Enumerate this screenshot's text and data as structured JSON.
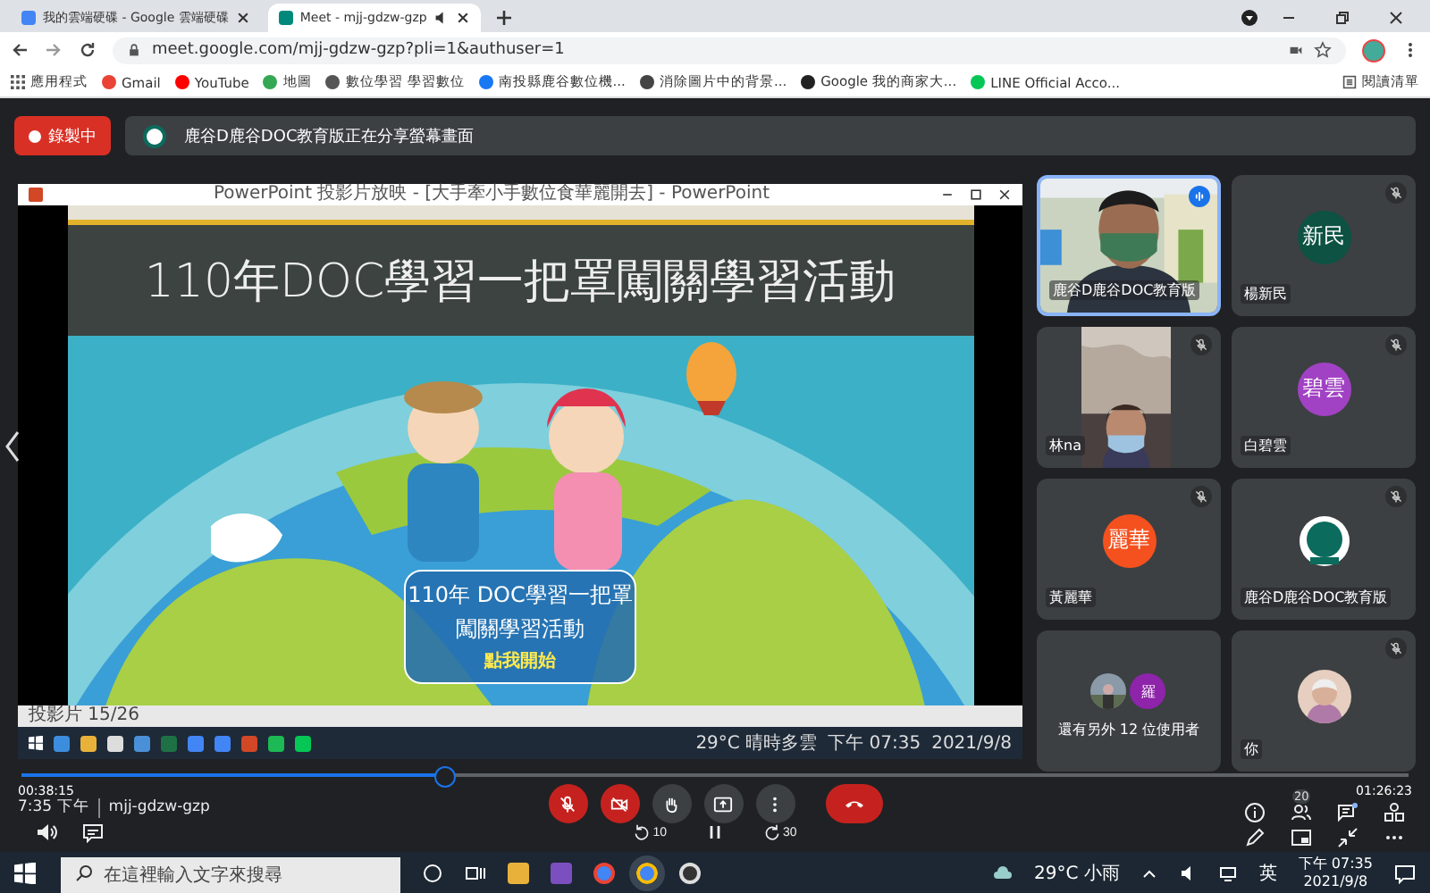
{
  "browser": {
    "tabs": [
      {
        "title": "我的雲端硬碟 - Google 雲端硬碟",
        "selected": false
      },
      {
        "title": "Meet - mjj-gdzw-gzp",
        "selected": true
      }
    ],
    "url": "meet.google.com/mjj-gdzw-gzp?pli=1&authuser=1",
    "bookmarks": [
      "應用程式",
      "Gmail",
      "YouTube",
      "地圖",
      "數位學習 學習數位",
      "南投縣鹿谷數位機...",
      "消除圖片中的背景...",
      "Google 我的商家大...",
      "LINE Official Acco..."
    ],
    "reading_list": "閱讀清單"
  },
  "meet": {
    "recording": "錄製中",
    "banner": "鹿谷D鹿谷DOC教育版正在分享螢幕畫面",
    "presentation": {
      "window_title": "PowerPoint 投影片放映 - [大手牽小手數位食華麗開去] - PowerPoint",
      "slide_title": "110年DOC學習一把罩闖關學習活動",
      "caption": [
        "110年 DOC學習一把罩",
        "闖關學習活動"
      ],
      "start_link": "點我開始",
      "status": "投影片 15/26",
      "taskbar": {
        "weather": "29°C 晴時多雲",
        "time": "下午 07:35",
        "date": "2021/9/8"
      }
    },
    "tiles": [
      {
        "kind": "video",
        "name": "鹿谷D鹿谷DOC教育版",
        "muted": false,
        "speaking": true
      },
      {
        "kind": "initials",
        "initials": "新民",
        "color": "#0d5243",
        "name": "楊新民",
        "muted": true,
        "speaking": false
      },
      {
        "kind": "video",
        "name": "林na",
        "muted": true,
        "speaking": false
      },
      {
        "kind": "initials",
        "initials": "碧雲",
        "color": "#a142c4",
        "name": "白碧雲",
        "muted": true,
        "speaking": false
      },
      {
        "kind": "initials",
        "initials": "麗華",
        "color": "#f4511e",
        "name": "黃麗華",
        "muted": true,
        "speaking": false
      },
      {
        "kind": "logo",
        "name": "鹿谷D鹿谷DOC教育版",
        "muted": true,
        "speaking": false
      },
      {
        "kind": "others",
        "label": "還有另外 12 位使用者",
        "initials": "羅",
        "color": "#8e24aa",
        "muted": false,
        "speaking": false
      },
      {
        "name": "你",
        "muted": true,
        "speaking": false
      }
    ],
    "player": {
      "elapsed": "00:38:15",
      "total": "01:26:23",
      "level": 0.305,
      "rewind": "10",
      "forward": "30"
    },
    "meeting_time": "7:35 下午",
    "meeting_code": "mjj-gdzw-gzp",
    "controls": [
      {
        "kind": "mic",
        "off": true
      },
      {
        "kind": "camera",
        "off": true
      },
      {
        "kind": "hand",
        "off": false
      },
      {
        "kind": "present",
        "off": false
      },
      {
        "kind": "more",
        "off": false
      },
      {
        "kind": "hangup"
      }
    ],
    "people_count": "20"
  },
  "taskbar": {
    "search_placeholder": "在這裡輸入文字來搜尋",
    "weather": "29°C 小雨",
    "language": "英",
    "time": "下午 07:35",
    "date": "2021/9/8"
  }
}
